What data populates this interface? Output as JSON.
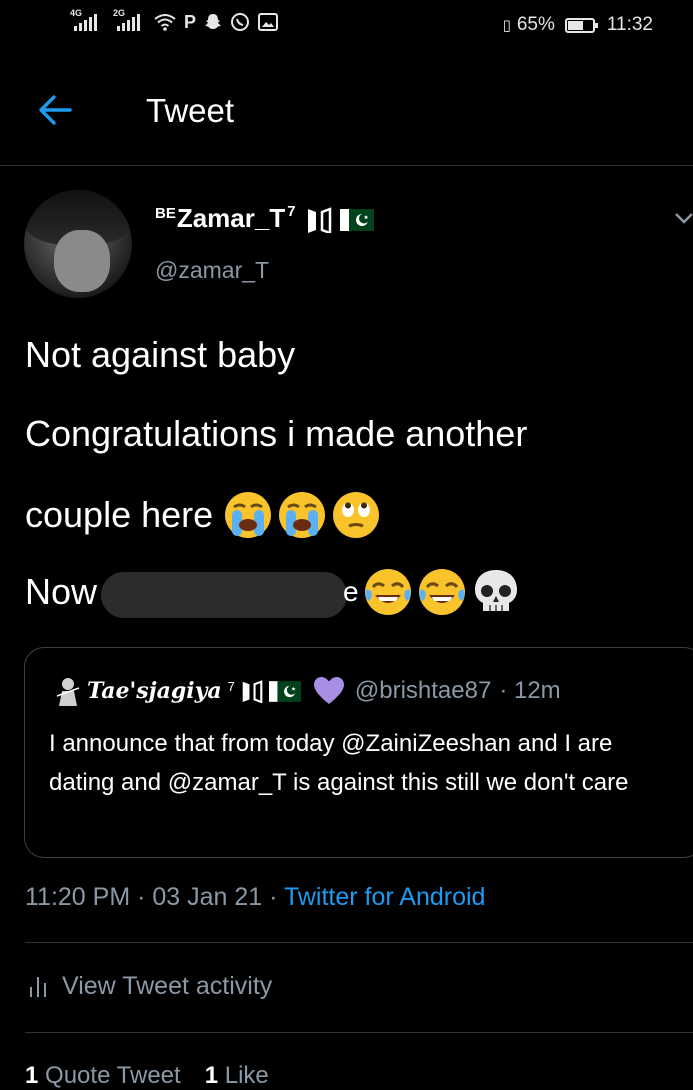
{
  "status_bar": {
    "network_1": "4G",
    "network_2": "2G",
    "battery": "65%",
    "time": "11:32",
    "battery_level": 0.65,
    "icons": [
      "signal-icon",
      "wifi-icon",
      "parking-icon",
      "snapchat-icon",
      "whatsapp-icon",
      "gallery-icon",
      "vibrate-icon",
      "battery-icon"
    ]
  },
  "header": {
    "title": "Tweet",
    "back_icon": "back-arrow-icon"
  },
  "author": {
    "name_prefix": "BE",
    "name": "Zamar_T",
    "name_sup": "7",
    "handle": "@zamar_T",
    "badges": [
      "bts-logo-icon",
      "pakistan-flag-icon"
    ]
  },
  "tweet": {
    "line1": "Not against baby",
    "line2": "Congratulations i made another",
    "line3": "couple here",
    "line3_emojis": [
      "😭",
      "😭",
      "🙄"
    ],
    "line4_start": "Now",
    "line4_end": "e",
    "line4_emojis": [
      "😂",
      "😂",
      "💀"
    ]
  },
  "quote": {
    "name": "Tae'sjagiya",
    "name_sup": "7",
    "heart": "💜",
    "handle": "@brishtae87",
    "time": "· 12m",
    "text": "I announce that from today @ZainiZeeshan and I are dating and @zamar_T  is against this still we don't care"
  },
  "meta": {
    "time": "11:20 PM",
    "date": "· 03 Jan 21 ·",
    "source": "Twitter for Android"
  },
  "activity": {
    "label": "View Tweet activity"
  },
  "stats": {
    "quote_count": "1",
    "quote_label": "Quote Tweet",
    "like_count": "1",
    "like_label": "Like"
  },
  "colors": {
    "background": "#000000",
    "accent": "#1d9bf0",
    "secondary_text": "#8b98a5",
    "divider": "#2f3336"
  }
}
